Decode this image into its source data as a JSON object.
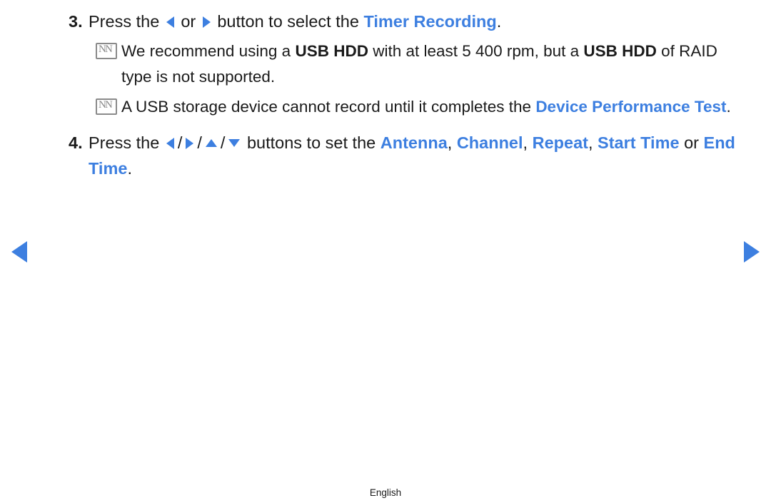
{
  "steps": [
    {
      "number": "3.",
      "text_pre": "Press the",
      "arrows": [
        "arrow-left-icon",
        "arrow-right-icon"
      ],
      "joiner": "or",
      "text_mid": "button to select the",
      "highlight": "Timer Recording",
      "text_end": "."
    },
    {
      "number": "4.",
      "text_pre": "Press the",
      "arrows": [
        "arrow-left-icon",
        "arrow-right-icon",
        "arrow-up-icon",
        "arrow-down-icon"
      ],
      "separator": "/",
      "text_mid": "buttons to set the",
      "highlights": [
        "Antenna",
        "Channel",
        "Repeat",
        "Start Time",
        "End Time"
      ],
      "comma": ",",
      "or_word": "or",
      "text_end": "."
    }
  ],
  "notes": [
    {
      "marker": "NN",
      "segment1": "We recommend using a ",
      "bold1": "USB HDD",
      "segment2": " with at least 5 400 rpm, but a ",
      "bold2": "USB HDD",
      "segment3": " of RAID type is not supported."
    },
    {
      "marker": "NN",
      "segment1": "A USB storage device cannot record until it completes the ",
      "blue1": "Device Performance Test",
      "segment2": "."
    }
  ],
  "navigation": {
    "prev_label": "prev-page-arrow",
    "next_label": "next-page-arrow"
  },
  "footer": {
    "language": "English"
  },
  "colors": {
    "accent": "#3d7fe0",
    "text": "#1a1a1a",
    "note_marker": "#8a8a8a"
  }
}
